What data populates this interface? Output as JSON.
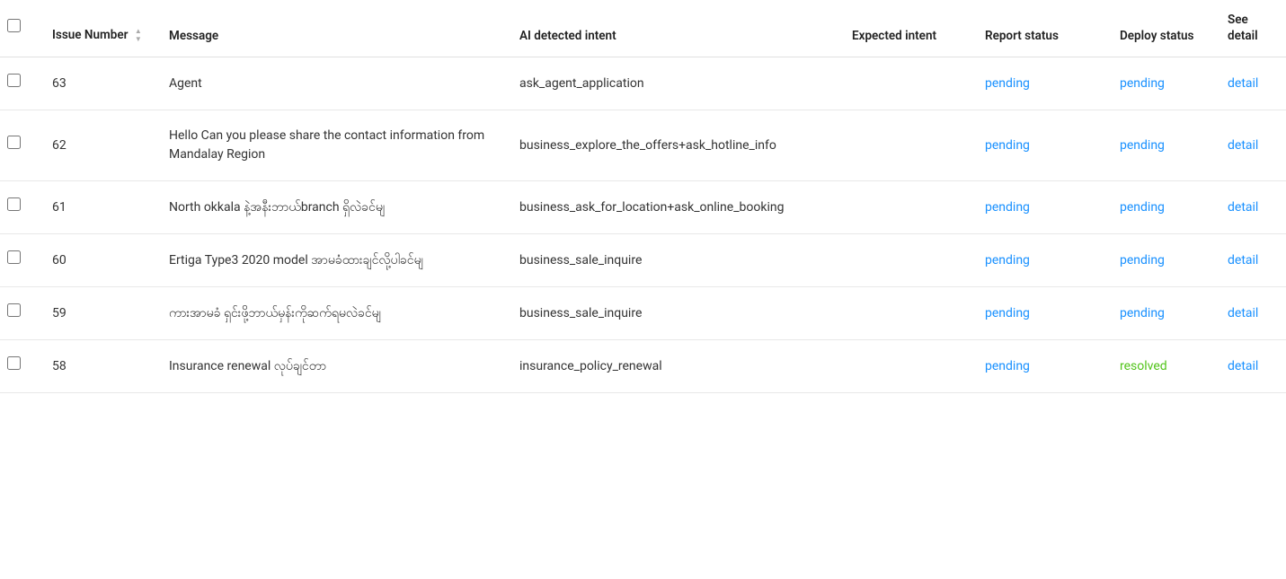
{
  "columns": [
    {
      "key": "checkbox",
      "label": ""
    },
    {
      "key": "issue_number",
      "label": "Issue Number",
      "sortable": true
    },
    {
      "key": "message",
      "label": "Message"
    },
    {
      "key": "ai_detected_intent",
      "label": "AI detected intent"
    },
    {
      "key": "expected_intent",
      "label": "Expected intent"
    },
    {
      "key": "report_status",
      "label": "Report status"
    },
    {
      "key": "deploy_status",
      "label": "Deploy status"
    },
    {
      "key": "see_detail",
      "label": "See detail"
    }
  ],
  "rows": [
    {
      "issue_number": "63",
      "message": "Agent",
      "ai_detected_intent": "ask_agent_application",
      "expected_intent": "",
      "report_status": "pending",
      "report_status_color": "blue",
      "deploy_status": "pending",
      "deploy_status_color": "blue",
      "see_detail": "detail"
    },
    {
      "issue_number": "62",
      "message": "Hello Can you please share the contact information from Mandalay Region",
      "ai_detected_intent": "business_explore_the_offers+ask_hotline_info",
      "expected_intent": "",
      "report_status": "pending",
      "report_status_color": "blue",
      "deploy_status": "pending",
      "deploy_status_color": "blue",
      "see_detail": "detail"
    },
    {
      "issue_number": "61",
      "message": "North okkala နဲ့အနီးဘာယ်branch ရှိလဲခင်မျ",
      "ai_detected_intent": "business_ask_for_location+ask_online_booking",
      "expected_intent": "",
      "report_status": "pending",
      "report_status_color": "blue",
      "deploy_status": "pending",
      "deploy_status_color": "blue",
      "see_detail": "detail"
    },
    {
      "issue_number": "60",
      "message": "Ertiga Type3 2020 model အာမခံထားချင်လို့ပါခင်မျ",
      "ai_detected_intent": "business_sale_inquire",
      "expected_intent": "",
      "report_status": "pending",
      "report_status_color": "blue",
      "deploy_status": "pending",
      "deploy_status_color": "blue",
      "see_detail": "detail"
    },
    {
      "issue_number": "59",
      "message": "ကားအာမခံ ရှင်းဖို့ဘာယ်မှန်းကိုဆက်ရမလဲခင်မျ",
      "ai_detected_intent": "business_sale_inquire",
      "expected_intent": "",
      "report_status": "pending",
      "report_status_color": "blue",
      "deploy_status": "pending",
      "deploy_status_color": "blue",
      "see_detail": "detail"
    },
    {
      "issue_number": "58",
      "message": "Insurance renewal လုပ်ချင်တာ",
      "ai_detected_intent": "insurance_policy_renewal",
      "expected_intent": "",
      "report_status": "pending",
      "report_status_color": "blue",
      "deploy_status": "resolved",
      "deploy_status_color": "green",
      "see_detail": "detail"
    }
  ]
}
